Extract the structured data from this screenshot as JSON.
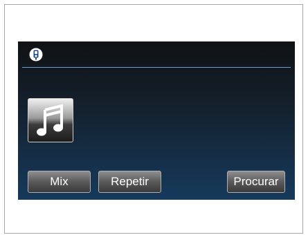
{
  "status_bar": {
    "source_icon": "ipod-icon"
  },
  "album_art": {
    "icon": "music-note-icon"
  },
  "buttons": {
    "mix_label": "Mix",
    "repeat_label": "Repetir",
    "search_label": "Procurar"
  },
  "colors": {
    "accent_line": "#6d9fd0",
    "screen_bottom": "#163a5c",
    "screen_top": "#101214"
  }
}
